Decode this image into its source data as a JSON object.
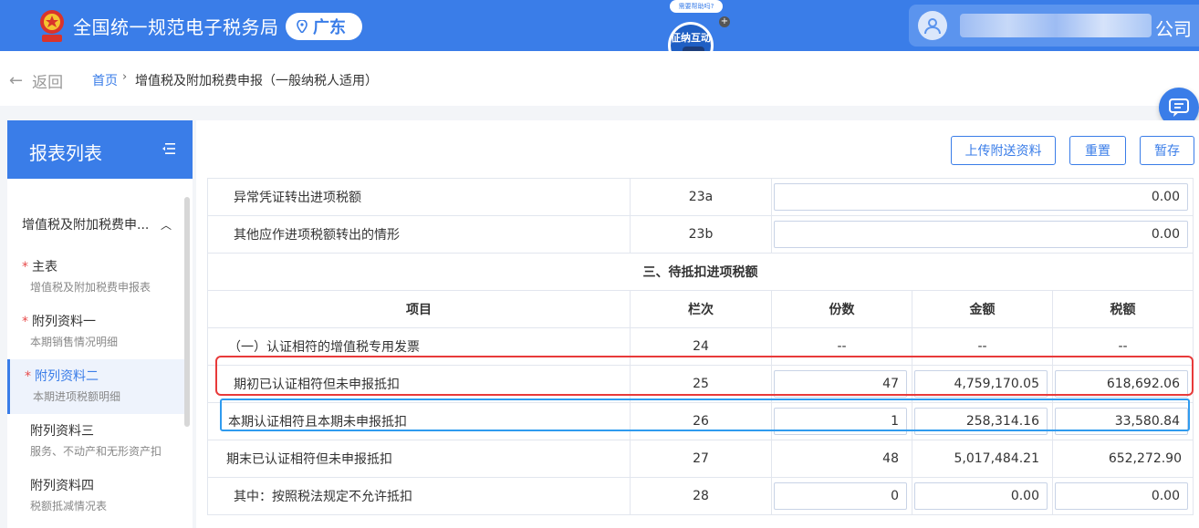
{
  "header": {
    "site_title": "全国统一规范电子税务局",
    "region": "广东",
    "user_name_suffix": "公司"
  },
  "mascot": {
    "bubble": "需要帮助吗?",
    "label": "征纳互动"
  },
  "breadcrumb": {
    "back": "返回",
    "home": "首页",
    "separator": "›",
    "current": "增值税及附加税费申报（一般纳税人适用）"
  },
  "sidebar": {
    "title": "报表列表",
    "group": "增值税及附加税费申...",
    "items": [
      {
        "label": "主表",
        "sub": "增值税及附加税费申报表",
        "required": "*"
      },
      {
        "label": "附列资料一",
        "sub": "本期销售情况明细",
        "required": "*"
      },
      {
        "label": "附列资料二",
        "sub": "本期进项税额明细",
        "required": "*"
      },
      {
        "label": "附列资料三",
        "sub": "服务、不动产和无形资产扣",
        "required": ""
      },
      {
        "label": "附列资料四",
        "sub": "税额抵减情况表",
        "required": ""
      }
    ]
  },
  "toolbar": {
    "upload": "上传附送资料",
    "reset": "重置",
    "save": "暂存"
  },
  "table": {
    "rows_top": [
      {
        "item": "异常凭证转出进项税额",
        "col": "23a",
        "value": "0.00"
      },
      {
        "item": "其他应作进项税额转出的情形",
        "col": "23b",
        "value": "0.00"
      }
    ],
    "section_title": "三、待抵扣进项税额",
    "headers": {
      "item": "项目",
      "col": "栏次",
      "count": "份数",
      "amount": "金额",
      "tax": "税额"
    },
    "row24": {
      "item": "（一）认证相符的增值税专用发票",
      "col": "24",
      "count": "--",
      "amount": "--",
      "tax": "--"
    },
    "row25": {
      "item": "期初已认证相符但未申报抵扣",
      "col": "25",
      "count": "47",
      "amount": "4,759,170.05",
      "tax": "618,692.06"
    },
    "row26": {
      "item": "本期认证相符且本期未申报抵扣",
      "col": "26",
      "count": "1",
      "amount": "258,314.16",
      "tax": "33,580.84"
    },
    "row27": {
      "item": "期末已认证相符但未申报抵扣",
      "col": "27",
      "count": "48",
      "amount": "5,017,484.21",
      "tax": "652,272.90"
    },
    "row28": {
      "item": "其中：按照税法规定不允许抵扣",
      "col": "28",
      "count": "0",
      "amount": "0.00",
      "tax": "0.00"
    }
  }
}
